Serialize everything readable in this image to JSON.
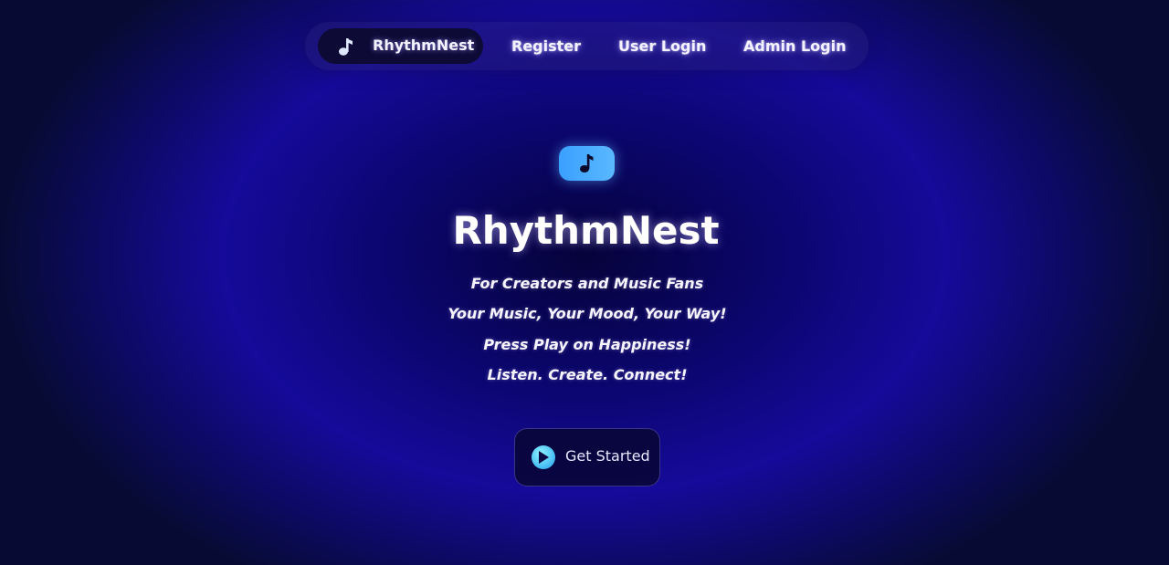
{
  "nav": {
    "brand": {
      "icon": "music-note-icon",
      "label": "RhythmNest"
    },
    "links": [
      {
        "label": "Register"
      },
      {
        "label": "User Login"
      },
      {
        "label": "Admin Login"
      }
    ]
  },
  "hero": {
    "icon": "music-note-icon",
    "title": "RhythmNest",
    "taglines": [
      "For Creators and Music Fans",
      "Your Music, Your Mood, Your Way!",
      "Press Play on Happiness!",
      "Listen. Create. Connect!"
    ],
    "cta": {
      "icon": "play-icon",
      "label": "Get Started"
    }
  },
  "colors": {
    "accent": "#3aa0ff",
    "background": "#150a9a",
    "nav_brand_bg": "#0d0a36"
  }
}
